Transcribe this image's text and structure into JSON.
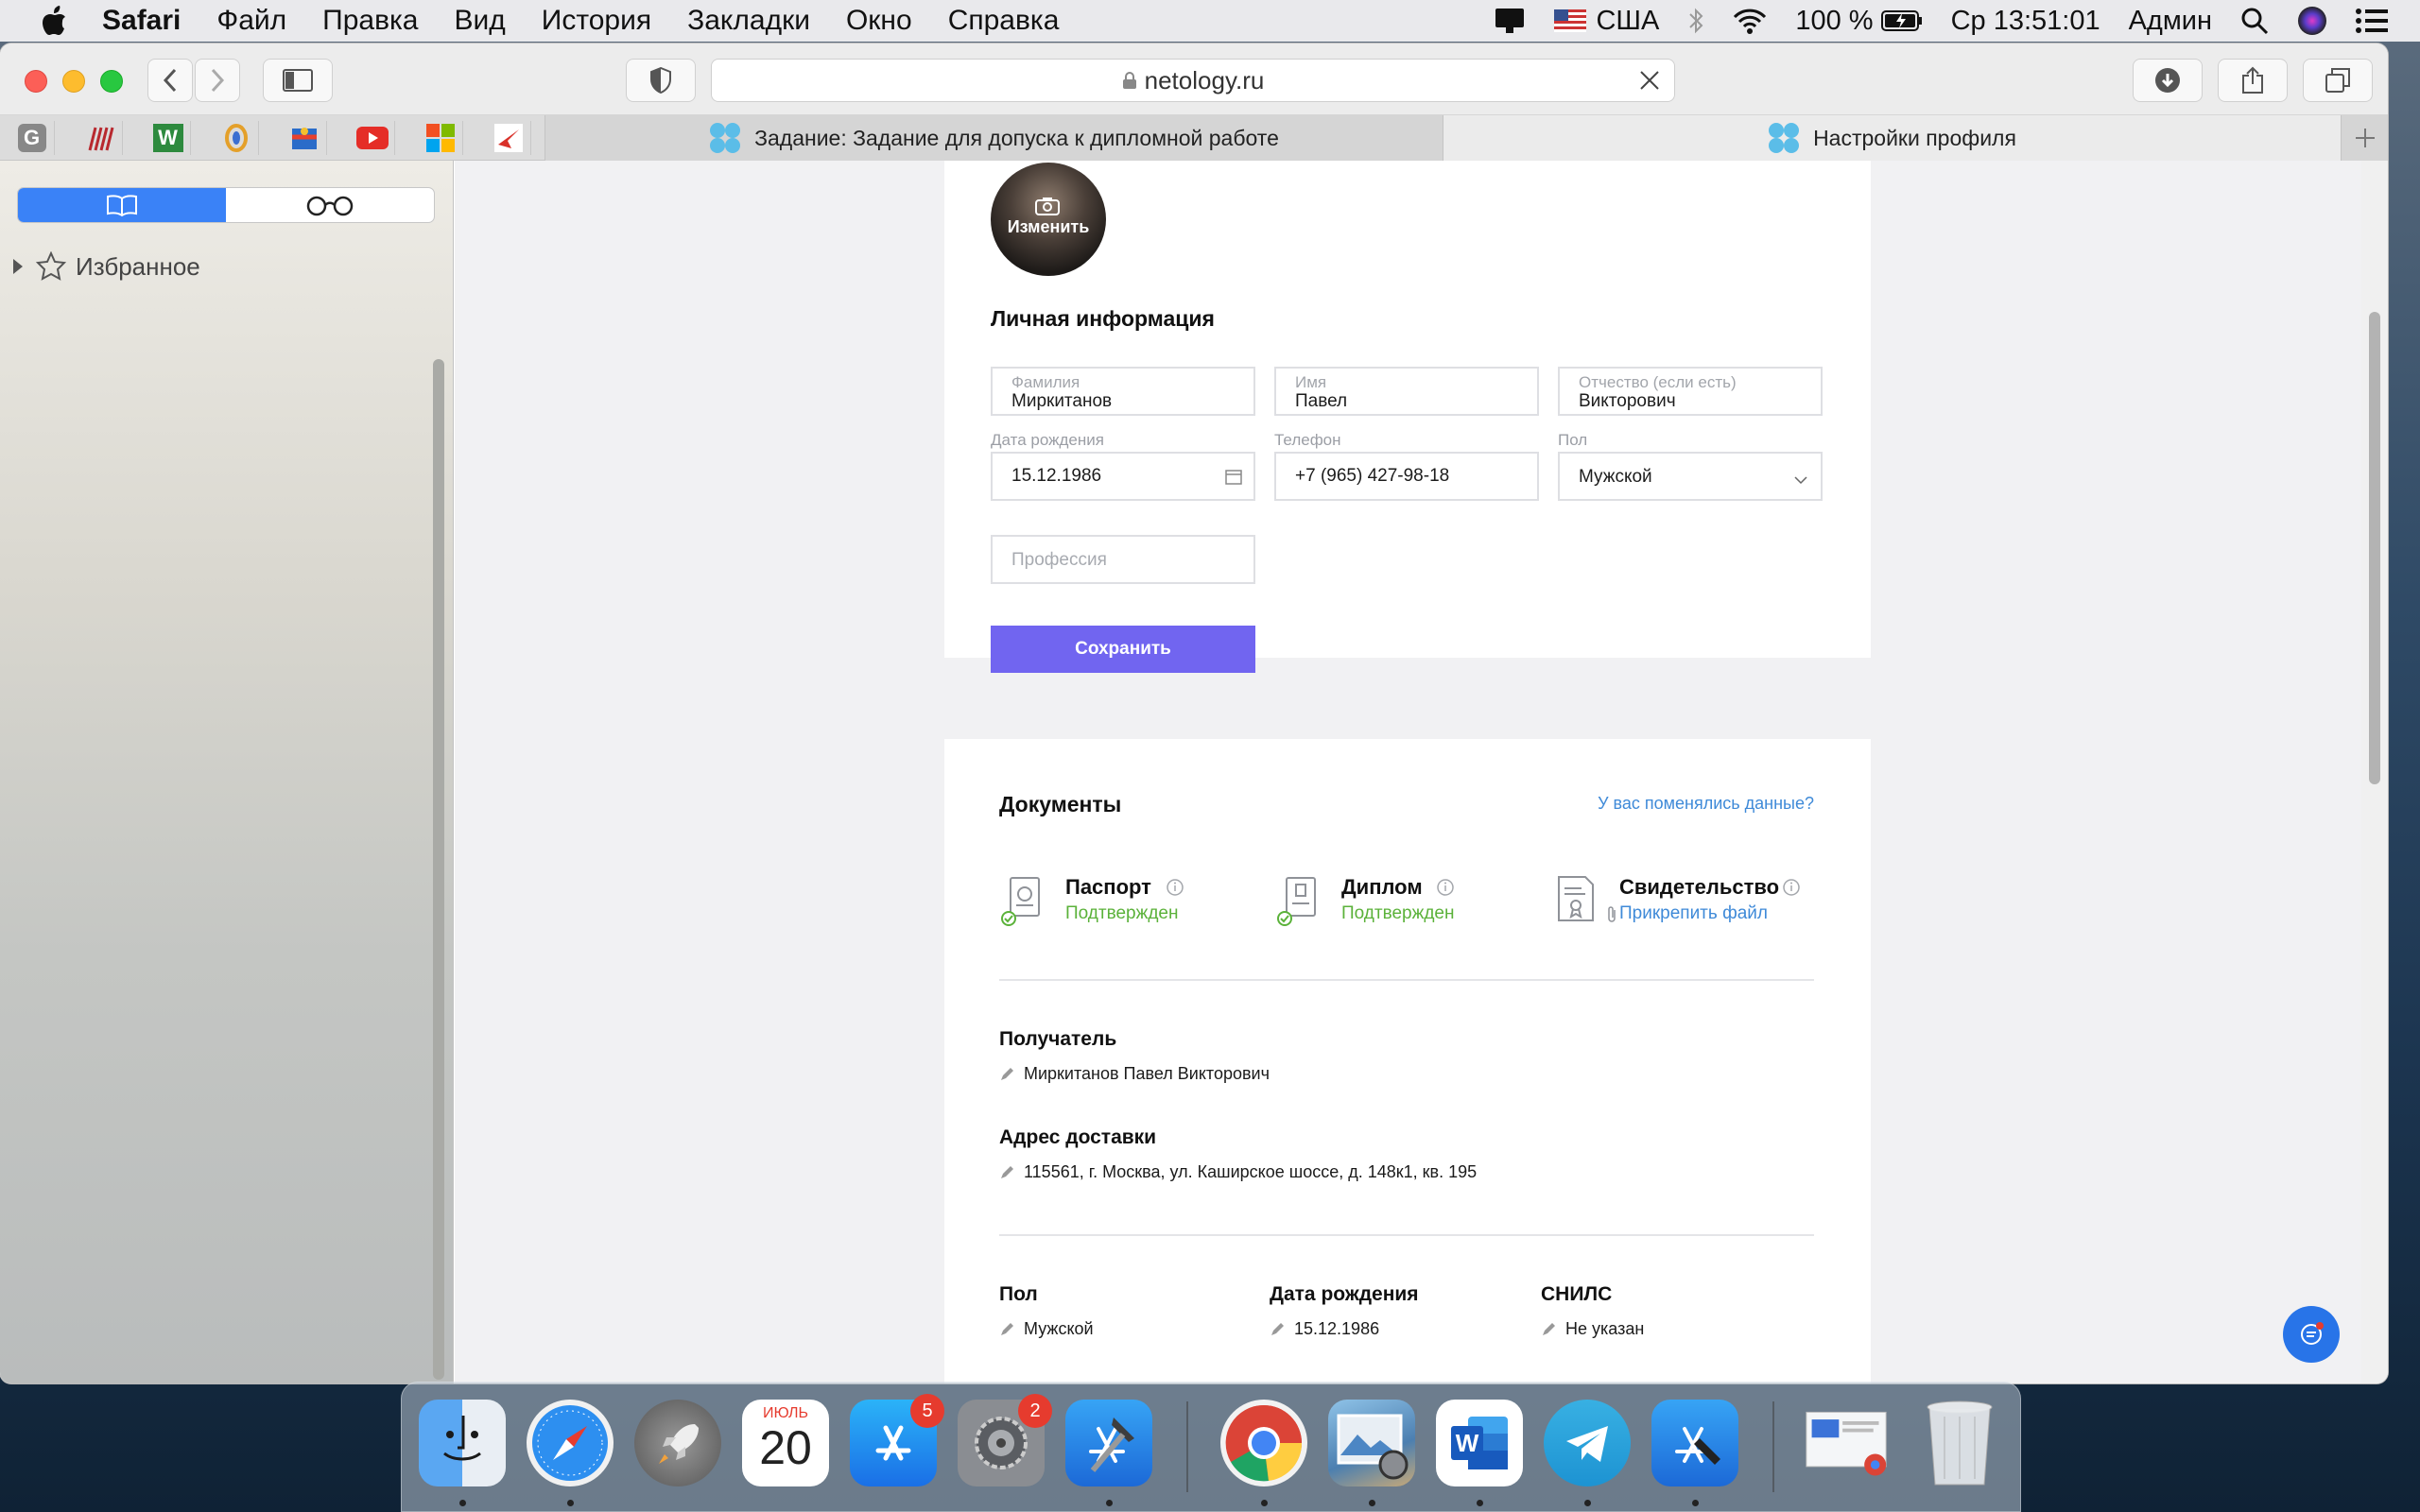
{
  "menubar": {
    "app": "Safari",
    "items": [
      "Файл",
      "Правка",
      "Вид",
      "История",
      "Закладки",
      "Окно",
      "Справка"
    ],
    "locale": "США",
    "battery": "100 %",
    "clock": "Ср 13:51:01",
    "user": "Админ"
  },
  "browser": {
    "url": "netology.ru",
    "tabs": [
      {
        "label": "Задание: Задание для допуска к дипломной работе"
      },
      {
        "label": "Настройки профиля"
      }
    ]
  },
  "sidebar": {
    "favorites": "Избранное"
  },
  "profile": {
    "avatar_change": "Изменить",
    "section_title": "Личная информация",
    "fields": {
      "surname": {
        "label": "Фамилия",
        "value": "Миркитанов"
      },
      "name": {
        "label": "Имя",
        "value": "Павел"
      },
      "patronymic": {
        "label": "Отчество (если есть)",
        "value": "Викторович"
      },
      "birthdate": {
        "label": "Дата рождения",
        "value": "15.12.1986"
      },
      "phone": {
        "label": "Телефон",
        "value": "+7 (965) 427-98-18"
      },
      "gender": {
        "label": "Пол",
        "value": "Мужской"
      },
      "profession": {
        "placeholder": "Профессия"
      }
    },
    "save": "Сохранить"
  },
  "documents": {
    "title": "Документы",
    "changed_link": "У вас поменялись данные?",
    "items": [
      {
        "title": "Паспорт",
        "status": "Подтвержден"
      },
      {
        "title": "Диплом",
        "status": "Подтвержден"
      },
      {
        "title": "Свидетельство",
        "status": "Прикрепить файл"
      }
    ],
    "recipient": {
      "title": "Получатель",
      "value": "Миркитанов Павел Викторович"
    },
    "address": {
      "title": "Адрес доставки",
      "value": "115561, г. Москва, ул. Каширское шоссе, д. 148к1, кв. 195"
    },
    "gender": {
      "title": "Пол",
      "value": "Мужской"
    },
    "birthdate": {
      "title": "Дата рождения",
      "value": "15.12.1986"
    },
    "snils": {
      "title": "СНИЛС",
      "value": "Не указан"
    }
  },
  "dock": {
    "calendar_month": "ИЮЛЬ",
    "calendar_day": "20",
    "appstore_badge": "5",
    "prefs_badge": "2"
  },
  "colors": {
    "accent": "#7165f0",
    "link": "#3f8ad8",
    "success": "#5bb23a",
    "chat": "#2874e8"
  }
}
